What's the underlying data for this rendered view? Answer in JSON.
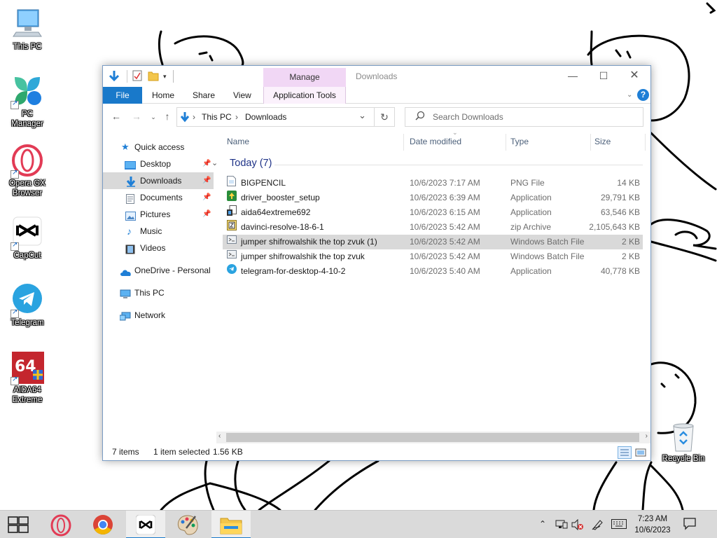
{
  "desktop": {
    "icons": [
      {
        "label": "This PC"
      },
      {
        "label": "PC Manager"
      },
      {
        "label": "Opera GX Browser"
      },
      {
        "label": "CapCut"
      },
      {
        "label": "Telegram"
      },
      {
        "label": "AIDA64 Extreme"
      },
      {
        "label": "Recycle Bin"
      }
    ]
  },
  "window": {
    "title": "Downloads",
    "contextual_tab": "Manage",
    "ribbon_tabs": [
      "File",
      "Home",
      "Share",
      "View",
      "Application Tools"
    ],
    "path": [
      "This PC",
      "Downloads"
    ],
    "search_placeholder": "Search Downloads",
    "nav": {
      "quick_access": "Quick access",
      "items": [
        "Desktop",
        "Downloads",
        "Documents",
        "Pictures",
        "Music",
        "Videos"
      ],
      "onedrive": "OneDrive - Personal",
      "this_pc": "This PC",
      "network": "Network"
    },
    "columns": [
      "Name",
      "Date modified",
      "Type",
      "Size"
    ],
    "group": "Today (7)",
    "files": [
      {
        "name": "BIGPENCIL",
        "date": "10/6/2023 7:17 AM",
        "type": "PNG File",
        "size": "14 KB"
      },
      {
        "name": "driver_booster_setup",
        "date": "10/6/2023 6:39 AM",
        "type": "Application",
        "size": "29,791 KB"
      },
      {
        "name": "aida64extreme692",
        "date": "10/6/2023 6:15 AM",
        "type": "Application",
        "size": "63,546 KB"
      },
      {
        "name": "davinci-resolve-18-6-1",
        "date": "10/6/2023 5:42 AM",
        "type": "zip Archive",
        "size": "2,105,643 KB"
      },
      {
        "name": "jumper shifrowalshik the top zvuk (1)",
        "date": "10/6/2023 5:42 AM",
        "type": "Windows Batch File",
        "size": "2 KB"
      },
      {
        "name": "jumper shifrowalshik the top zvuk",
        "date": "10/6/2023 5:42 AM",
        "type": "Windows Batch File",
        "size": "2 KB"
      },
      {
        "name": "telegram-for-desktop-4-10-2",
        "date": "10/6/2023 5:40 AM",
        "type": "Application",
        "size": "40,778 KB"
      }
    ],
    "status": {
      "count": "7 items",
      "selected": "1 item selected",
      "size": "1.56 KB"
    }
  },
  "taskbar": {
    "time": "7:23 AM",
    "date": "10/6/2023"
  }
}
